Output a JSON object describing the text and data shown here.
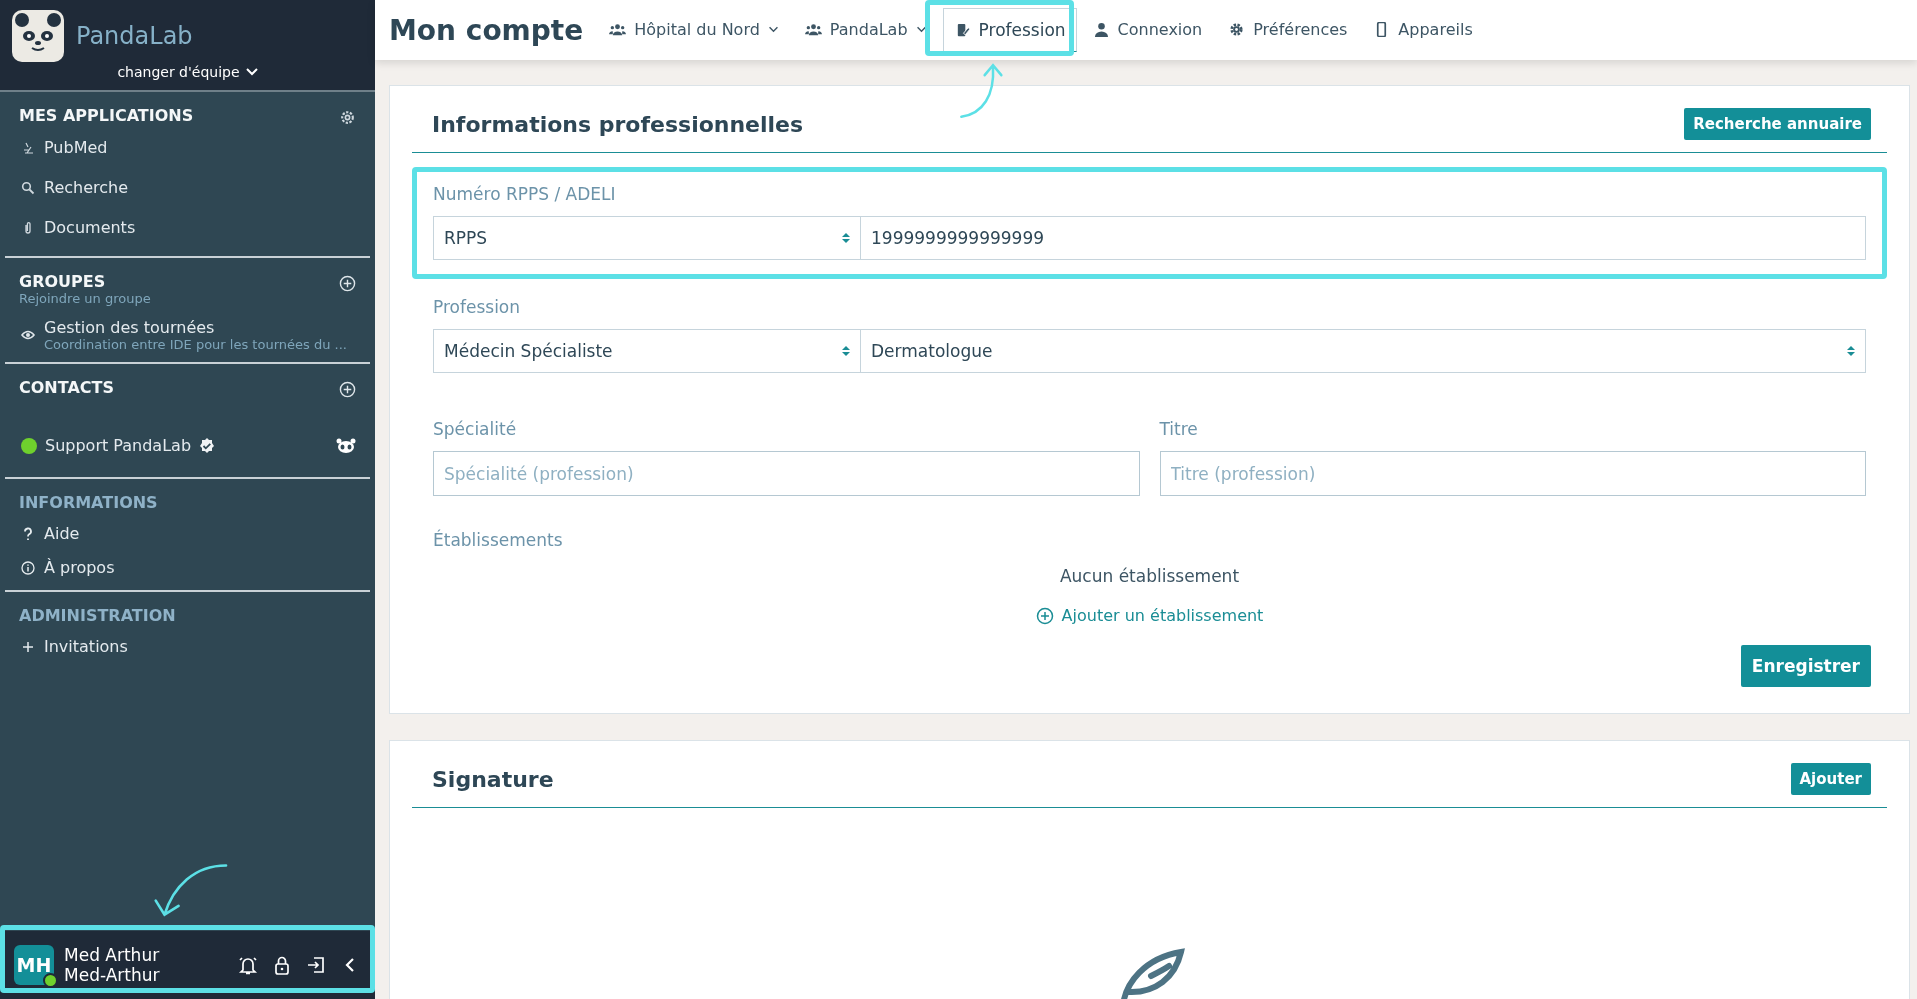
{
  "sidebar": {
    "app_name": "PandaLab",
    "team_switcher": "changer d'équipe",
    "sections": [
      {
        "kind": "apps",
        "title": "MES APPLICATIONS",
        "dimmed": false,
        "items": [
          {
            "label": "PubMed"
          },
          {
            "label": "Recherche"
          },
          {
            "label": "Documents"
          }
        ]
      },
      {
        "kind": "groups",
        "title": "GROUPES",
        "subtitle": "Rejoindre un groupe",
        "dimmed": false,
        "items": [
          {
            "label": "Gestion des tournées",
            "subtitle": "Coordination entre IDE pour les tournées du ..."
          }
        ]
      },
      {
        "kind": "contacts",
        "title": "CONTACTS",
        "dimmed": false,
        "items": [
          {
            "label": "Support PandaLab",
            "online": true,
            "verified": true
          }
        ]
      },
      {
        "kind": "links",
        "title": "INFORMATIONS",
        "dimmed": true,
        "items": [
          {
            "label": "Aide"
          },
          {
            "label": "À propos"
          }
        ]
      },
      {
        "kind": "links",
        "title": "ADMINISTRATION",
        "dimmed": true,
        "items": [
          {
            "label": "Invitations"
          }
        ]
      }
    ],
    "user": {
      "initials": "MH",
      "online": true,
      "name": "Med Arthur",
      "username": "Med-Arthur"
    }
  },
  "header": {
    "title": "Mon compte",
    "tabs": [
      {
        "label": "Hôpital du Nord",
        "dropdown": true,
        "selected": false
      },
      {
        "label": "PandaLab",
        "dropdown": true,
        "selected": false
      },
      {
        "label": "Profession",
        "dropdown": false,
        "selected": true
      },
      {
        "label": "Connexion",
        "dropdown": false,
        "selected": false
      },
      {
        "label": "Préférences",
        "dropdown": false,
        "selected": false
      },
      {
        "label": "Appareils",
        "dropdown": false,
        "selected": false
      }
    ]
  },
  "professional_card": {
    "title": "Informations professionnelles",
    "search_button": "Recherche annuaire",
    "rpps": {
      "label": "Numéro RPPS / ADELI",
      "type_select": "RPPS",
      "value": "1999999999999999"
    },
    "profession": {
      "label": "Profession",
      "category_select": "Médecin Spécialiste",
      "specialty_select": "Dermatologue"
    },
    "specialite": {
      "label": "Spécialité",
      "placeholder": "Spécialité (profession)"
    },
    "titre": {
      "label": "Titre",
      "placeholder": "Titre (profession)"
    },
    "etablissements": {
      "label": "Établissements",
      "empty": "Aucun établissement",
      "add_link": "Ajouter un établissement"
    },
    "save_button": "Enregistrer"
  },
  "signature_card": {
    "title": "Signature",
    "add_button": "Ajouter"
  }
}
